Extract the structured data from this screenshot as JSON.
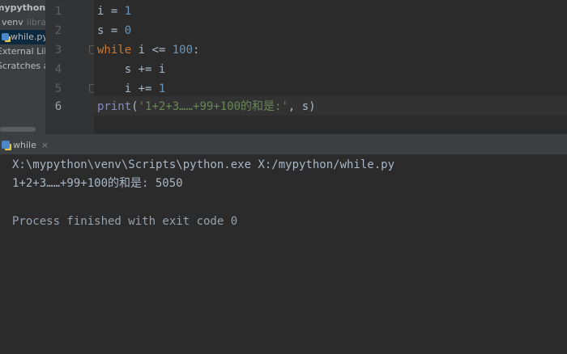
{
  "project": {
    "root_label": "mypython",
    "root_close": "X",
    "venv_label": "venv",
    "venv_hint": "librar",
    "file_label": "while.py",
    "external": "External Libraries",
    "scratches": "Scratches and Consoles"
  },
  "editor": {
    "line_numbers": [
      "1",
      "2",
      "3",
      "4",
      "5",
      "6"
    ],
    "lines": [
      {
        "a": "i = ",
        "b": "1"
      },
      {
        "a": "s = ",
        "b": "0"
      },
      {
        "kw": "while",
        "a": " i <= ",
        "b": "100",
        "c": ":"
      },
      {
        "a": "    s += i"
      },
      {
        "a": "    i += ",
        "b": "1"
      },
      {
        "fn": "print",
        "a": "(",
        "str": "'1+2+3……+99+100的和是:'",
        "c": ", s)"
      }
    ]
  },
  "run": {
    "tab_label": "while",
    "tab_close": "×",
    "console": [
      "X:\\mypython\\venv\\Scripts\\python.exe X:/mypython/while.py",
      "1+2+3……+99+100的和是: 5050",
      "",
      "Process finished with exit code 0"
    ]
  },
  "colors": {
    "keyword": "#cc7832",
    "number": "#6897bb",
    "string": "#6a8759",
    "builtin": "#8888c6",
    "text": "#a9b7c6",
    "background": "#2b2b2b"
  }
}
